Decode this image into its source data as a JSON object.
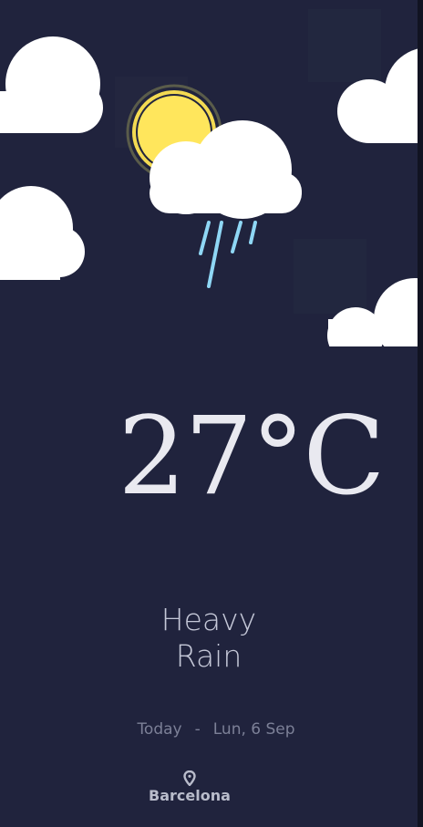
{
  "weather": {
    "temperature": "27°C",
    "condition_line1": "Heavy",
    "condition_line2": "Rain",
    "day_label": "Today",
    "separator": "-",
    "date": "Lun, 6 Sep",
    "city": "Barcelona",
    "icon": "sun-cloud-rain-icon"
  },
  "colors": {
    "background": "#20233d",
    "cloud": "#ffffff",
    "sun": "#ffe65c",
    "rain": "#8fd7f5"
  },
  "icons": {
    "location": "map-pin-icon"
  }
}
